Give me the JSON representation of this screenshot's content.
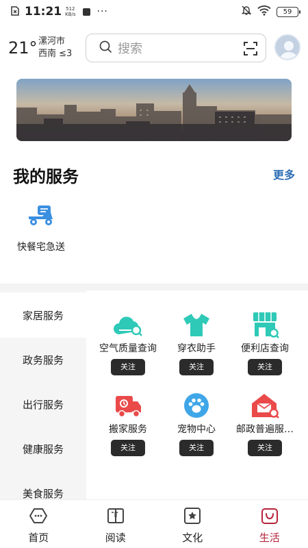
{
  "status_bar": {
    "time": "11:21",
    "speed_value": "512",
    "speed_unit": "KB/s",
    "dots": "···",
    "battery": "59"
  },
  "weather": {
    "temperature": "21°",
    "city": "漯河市",
    "wind": "西南  ≤3"
  },
  "search": {
    "placeholder": "搜索"
  },
  "my_services": {
    "title": "我的服务",
    "more": "更多",
    "items": [
      {
        "label": "快餐宅急送",
        "icon": "scooter-icon"
      }
    ]
  },
  "categories": {
    "side": [
      {
        "label": "家居服务",
        "active": true
      },
      {
        "label": "政务服务",
        "active": false
      },
      {
        "label": "出行服务",
        "active": false
      },
      {
        "label": "健康服务",
        "active": false
      },
      {
        "label": "美食服务",
        "active": false
      }
    ],
    "items": [
      {
        "name": "空气质量查询",
        "button": "关注",
        "icon": "air-quality-icon",
        "color": "#2ec9b7"
      },
      {
        "name": "穿衣助手",
        "button": "关注",
        "icon": "tshirt-icon",
        "color": "#2ec9b7"
      },
      {
        "name": "便利店查询",
        "button": "关注",
        "icon": "store-icon",
        "color": "#2ec9b7"
      },
      {
        "name": "搬家服务",
        "button": "关注",
        "icon": "moving-truck-icon",
        "color": "#ea4a4a"
      },
      {
        "name": "宠物中心",
        "button": "关注",
        "icon": "paw-icon",
        "color": "#3fa6e8"
      },
      {
        "name": "邮政普遍服…",
        "button": "关注",
        "icon": "post-office-icon",
        "color": "#ea4a4a"
      }
    ]
  },
  "bottom_nav": [
    {
      "label": "首页",
      "icon": "home-icon",
      "active": false
    },
    {
      "label": "阅读",
      "icon": "book-icon",
      "active": false
    },
    {
      "label": "文化",
      "icon": "culture-icon",
      "active": false
    },
    {
      "label": "生活",
      "icon": "life-icon",
      "active": true
    }
  ],
  "colors": {
    "accent": "#b5243b",
    "link": "#2f6fb5",
    "teal": "#2ec9b7",
    "red": "#ea4a4a",
    "blue": "#3fa6e8"
  }
}
